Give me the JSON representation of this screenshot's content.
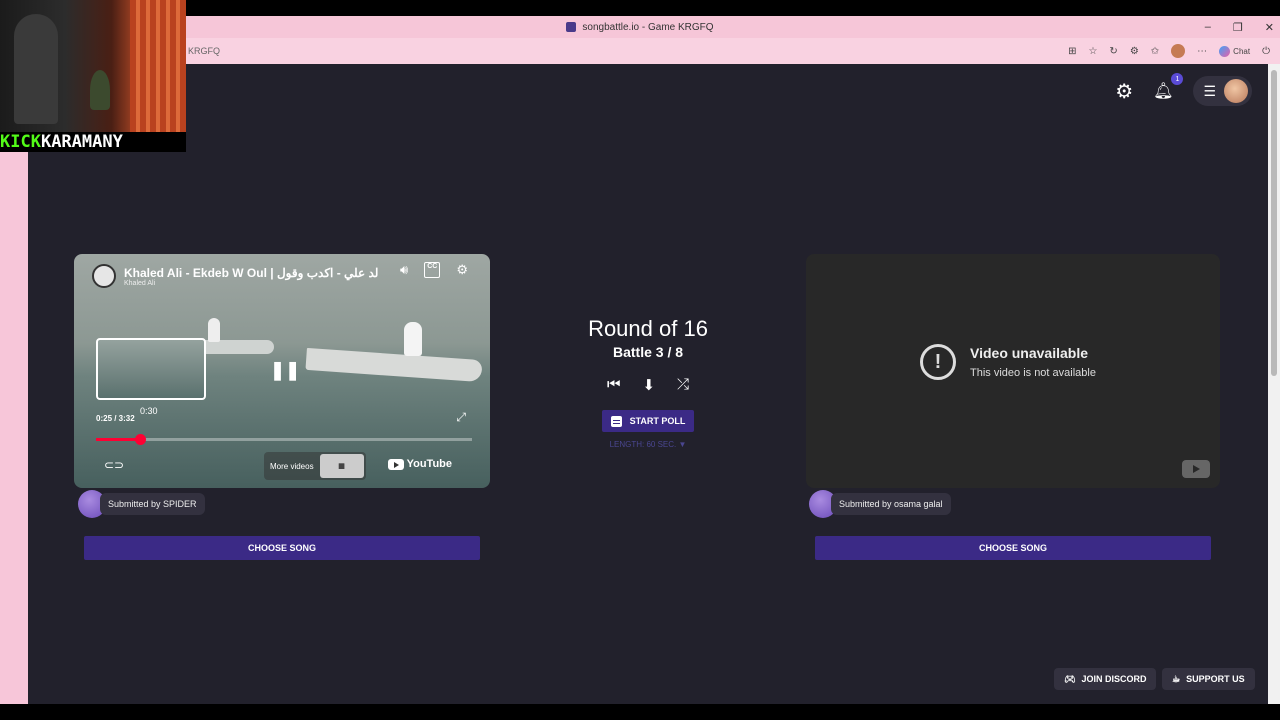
{
  "browser": {
    "title": "songbattle.io - Game KRGFQ",
    "address": "KRGFQ",
    "chat_label": "Chat",
    "window_controls": [
      "–",
      "❐",
      "✕"
    ]
  },
  "header": {
    "notification_count": "1"
  },
  "left_video": {
    "title": "Khaled Ali - Ekdeb W Oul | لد علي - اكدب وقول",
    "channel": "Khaled Ali",
    "cc_label": "CC",
    "hover_time": "0:30",
    "time": "0:25 / 3:32",
    "progress": 0.118,
    "more_videos_label": "More videos",
    "youtube_label": "YouTube"
  },
  "right_video": {
    "unavailable_title": "Video unavailable",
    "unavailable_sub": "This video is not available"
  },
  "left_submitter": {
    "label": "Submitted by SPIDER",
    "choose_label": "CHOOSE SONG"
  },
  "right_submitter": {
    "label": "Submitted by osama galal",
    "choose_label": "CHOOSE SONG"
  },
  "center": {
    "round": "Round of 16",
    "battle": "Battle 3 / 8",
    "start_poll": "START POLL",
    "length": "LENGTH: 60 SEC. ▼"
  },
  "footer": {
    "discord": "JOIN DISCORD",
    "support": "SUPPORT US"
  },
  "overlay": {
    "kick_part1": "KICK",
    "kick_part2": "KARAMANY"
  },
  "colors": {
    "page_bg": "#22212c",
    "accent": "#3b2a86",
    "browser_pink": "#f6c6d8",
    "youtube_red": "#ff0033"
  }
}
